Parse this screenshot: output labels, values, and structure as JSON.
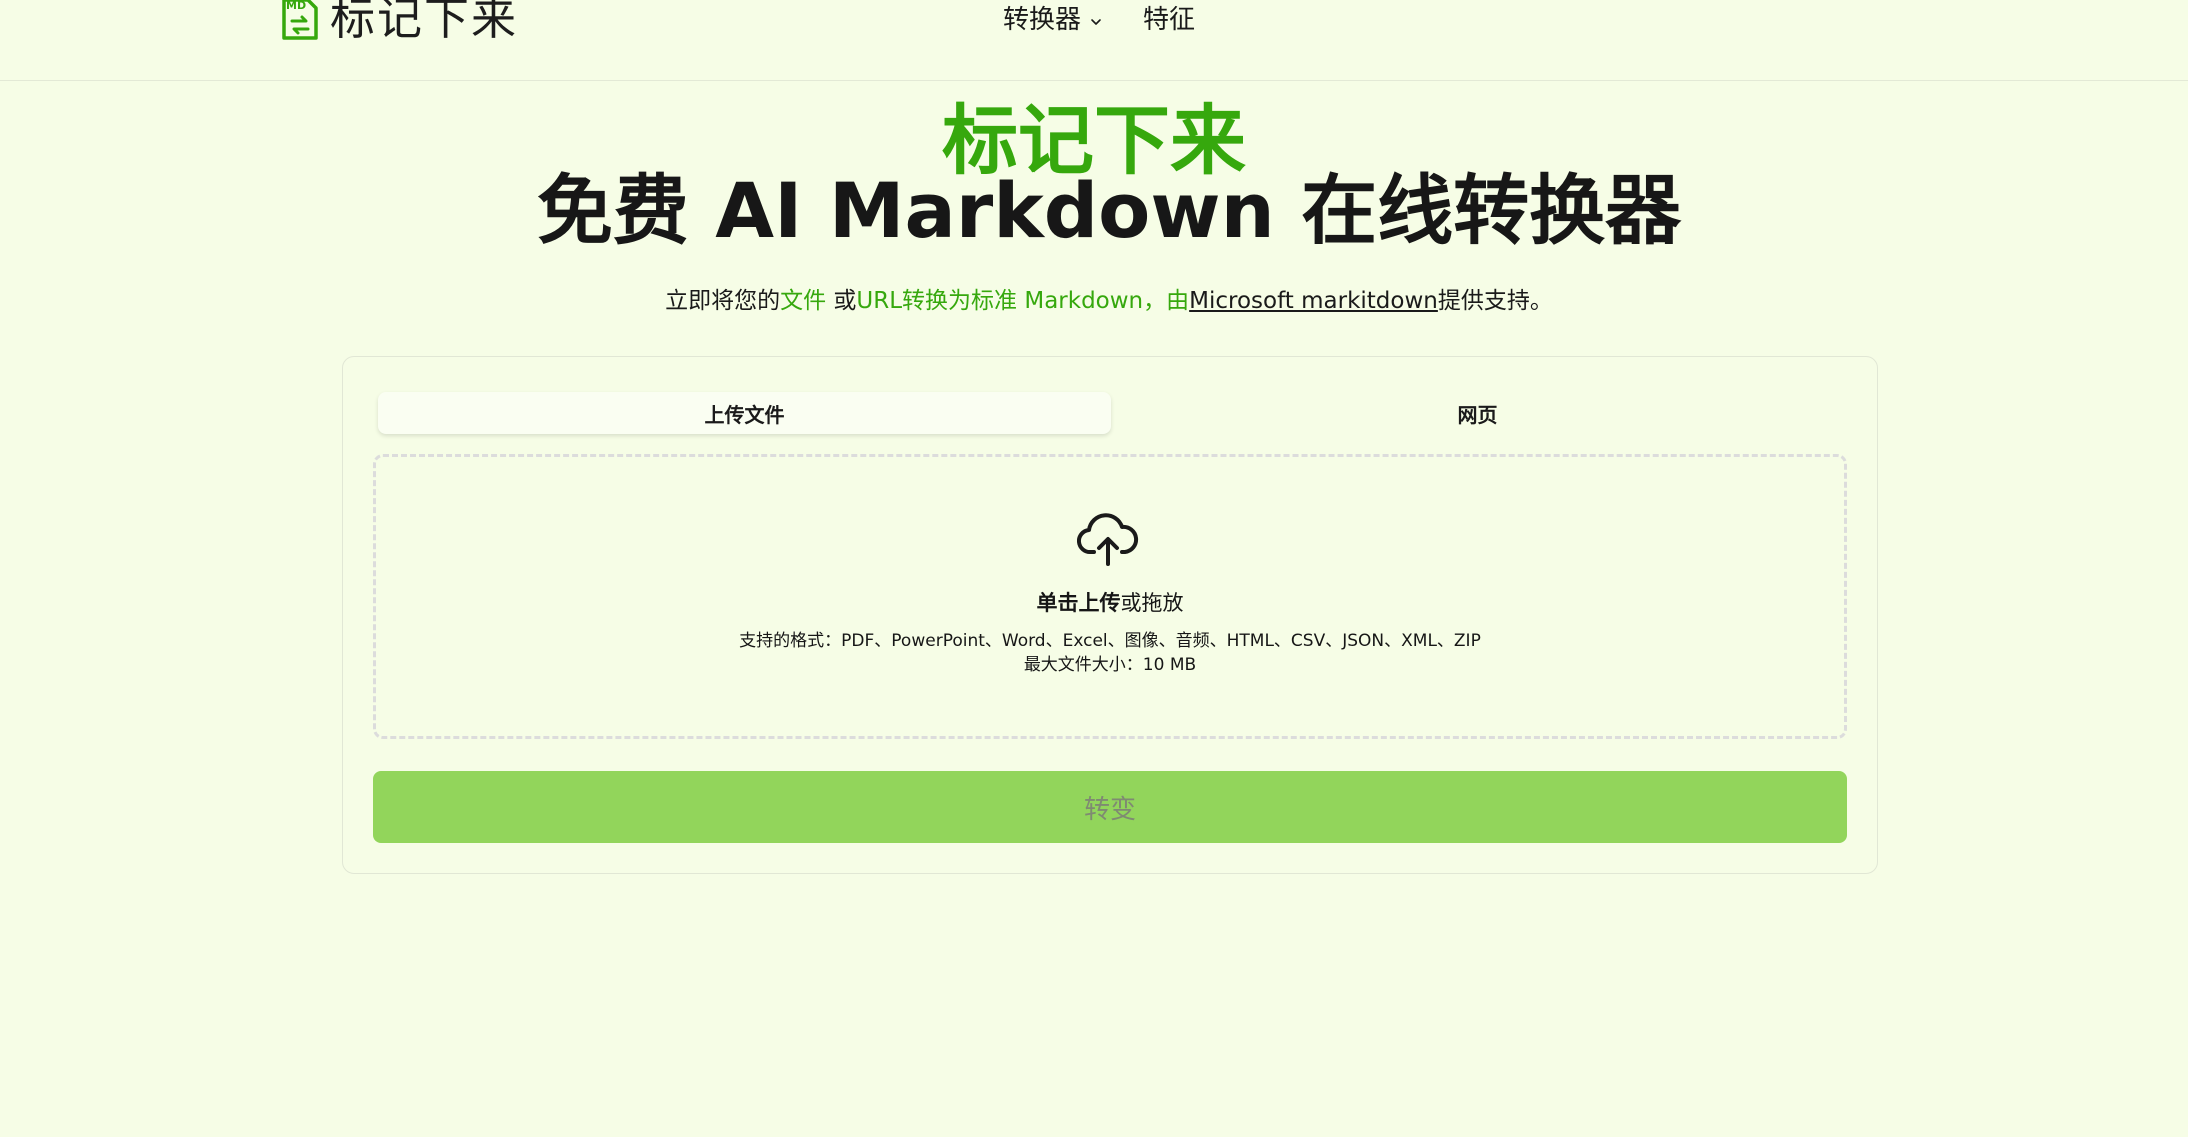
{
  "header": {
    "logo_text": "标记下来",
    "nav": [
      {
        "label": "转换器",
        "has_dropdown": true
      },
      {
        "label": "特征",
        "has_dropdown": false
      }
    ]
  },
  "hero": {
    "title_line1": "标记下来",
    "title_line2": "免费 AI Markdown 在线转换器",
    "subtitle": {
      "prefix": "立即将您的",
      "file": "文件",
      "or": " 或",
      "url_text": "URL转换为标准 Markdown，由",
      "link": "Microsoft markitdown",
      "suffix": "提供支持。"
    }
  },
  "converter": {
    "tabs": [
      {
        "label": "上传文件",
        "active": true
      },
      {
        "label": "网页",
        "active": false
      }
    ],
    "dropzone": {
      "click_upload": "单击上传",
      "or_drag": "或拖放",
      "formats": "支持的格式：PDF、PowerPoint、Word、Excel、图像、音频、HTML、CSV、JSON、XML、ZIP",
      "max_size": "最大文件大小：10 MB"
    },
    "convert_label": "转变"
  },
  "colors": {
    "background": "#f6fde6",
    "brand_green": "#36a80d",
    "button_green": "#92d55b"
  },
  "icons": [
    "markdown-file-logo-icon",
    "chevron-down-icon",
    "cloud-upload-icon"
  ]
}
